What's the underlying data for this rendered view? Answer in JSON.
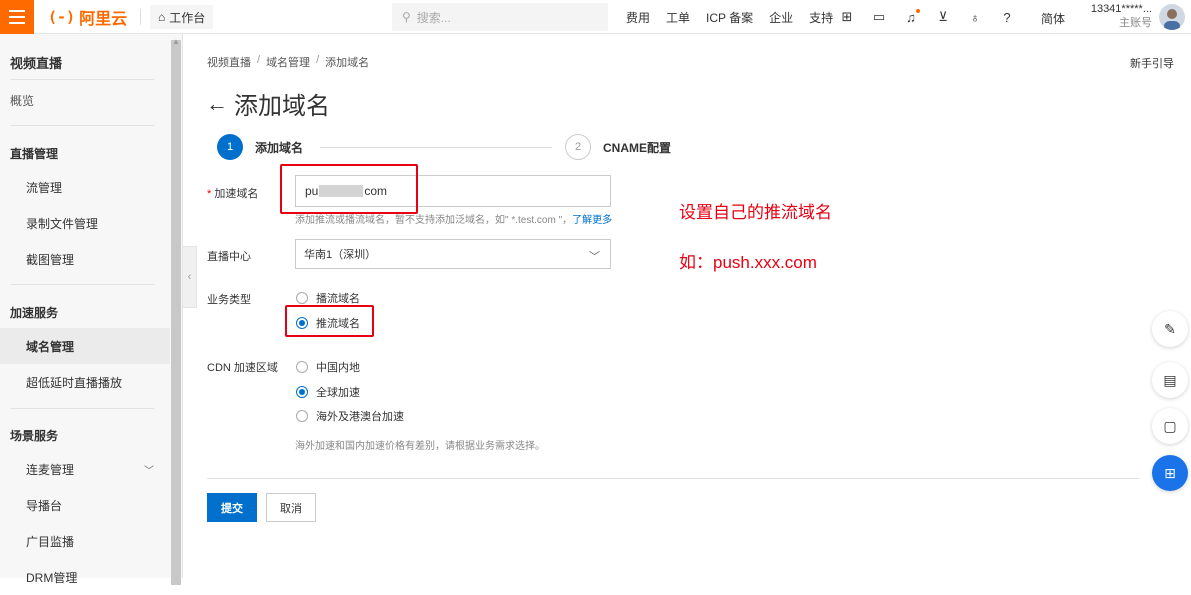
{
  "topbar": {
    "logo_text": "阿里云",
    "logo_mark": "(-)",
    "workbench": "工作台",
    "search_placeholder": "搜索...",
    "nav": [
      "费用",
      "工单",
      "ICP 备案",
      "企业",
      "支持"
    ],
    "lang": "简体",
    "account_name": "13341*****...",
    "account_sub": "主账号"
  },
  "sidebar": {
    "title": "视频直播",
    "overview": "概览",
    "groups": [
      {
        "label": "直播管理",
        "items": [
          "流管理",
          "录制文件管理",
          "截图管理"
        ]
      },
      {
        "label": "加速服务",
        "items": [
          "域名管理",
          "超低延时直播播放"
        ]
      },
      {
        "label": "场景服务",
        "items": [
          "连麦管理",
          "导播台",
          "广目监播",
          "DRM管理"
        ]
      }
    ],
    "active": "域名管理"
  },
  "breadcrumb": [
    "视频直播",
    "域名管理",
    "添加域名"
  ],
  "guide": "新手引导",
  "page_title": "添加域名",
  "steps": [
    {
      "num": "1",
      "label": "添加域名"
    },
    {
      "num": "2",
      "label": "CNAME配置"
    }
  ],
  "form": {
    "domain_label": "加速域名",
    "domain_required": "*",
    "domain_value_start": "pu",
    "domain_value_end": "com",
    "domain_hint": "添加推流或播流域名，暂不支持添加泛域名，如\" *.test.com \"，",
    "domain_hint_link": "了解更多",
    "center_label": "直播中心",
    "center_value": "华南1（深圳）",
    "biz_label": "业务类型",
    "biz_options": [
      "播流域名",
      "推流域名"
    ],
    "biz_selected": 1,
    "cdn_label": "CDN 加速区域",
    "cdn_options": [
      "中国内地",
      "全球加速",
      "海外及港澳台加速"
    ],
    "cdn_selected": 1,
    "cdn_note": "海外加速和国内加速价格有差别，请根据业务需求选择。",
    "submit": "提交",
    "cancel": "取消"
  },
  "annotations": {
    "line1": "设置自己的推流域名",
    "line2": "如：push.xxx.com",
    "color": "#e60012"
  },
  "colors": {
    "brand": "#ff6a00",
    "primary": "#0070cc"
  }
}
